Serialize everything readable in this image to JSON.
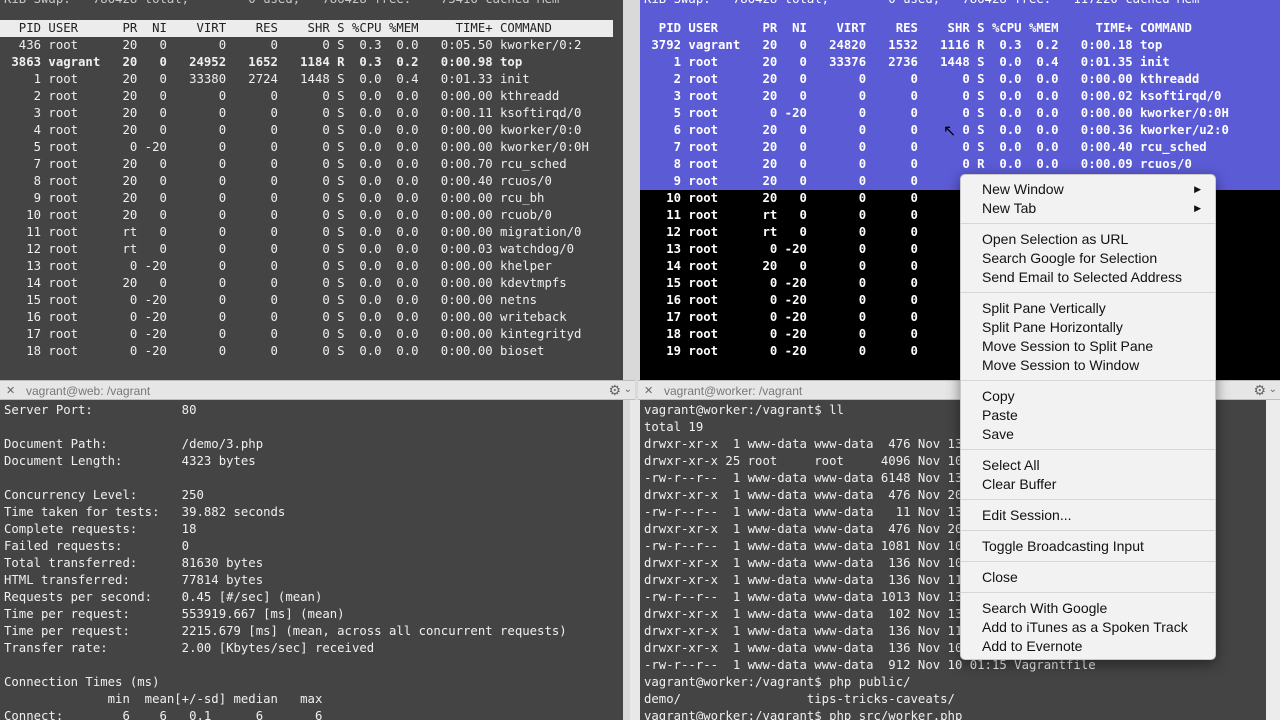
{
  "top_left": {
    "swap_line": "KiB Swap:   786428 total,        0 used,   786428 free.    73416 cached Mem",
    "header": "  PID USER      PR  NI    VIRT    RES    SHR S %CPU %MEM     TIME+ COMMAND",
    "rows": [
      {
        "text": "  436 root      20   0       0      0      0 S  0.3  0.0   0:05.50 kworker/0:2",
        "bold": false
      },
      {
        "text": " 3863 vagrant   20   0   24952   1652   1184 R  0.3  0.2   0:00.98 top",
        "bold": true
      },
      {
        "text": "    1 root      20   0   33380   2724   1448 S  0.0  0.4   0:01.33 init",
        "bold": false
      },
      {
        "text": "    2 root      20   0       0      0      0 S  0.0  0.0   0:00.00 kthreadd",
        "bold": false
      },
      {
        "text": "    3 root      20   0       0      0      0 S  0.0  0.0   0:00.11 ksoftirqd/0",
        "bold": false
      },
      {
        "text": "    4 root      20   0       0      0      0 S  0.0  0.0   0:00.00 kworker/0:0",
        "bold": false
      },
      {
        "text": "    5 root       0 -20       0      0      0 S  0.0  0.0   0:00.00 kworker/0:0H",
        "bold": false
      },
      {
        "text": "    7 root      20   0       0      0      0 S  0.0  0.0   0:00.70 rcu_sched",
        "bold": false
      },
      {
        "text": "    8 root      20   0       0      0      0 S  0.0  0.0   0:00.40 rcuos/0",
        "bold": false
      },
      {
        "text": "    9 root      20   0       0      0      0 S  0.0  0.0   0:00.00 rcu_bh",
        "bold": false
      },
      {
        "text": "   10 root      20   0       0      0      0 S  0.0  0.0   0:00.00 rcuob/0",
        "bold": false
      },
      {
        "text": "   11 root      rt   0       0      0      0 S  0.0  0.0   0:00.00 migration/0",
        "bold": false
      },
      {
        "text": "   12 root      rt   0       0      0      0 S  0.0  0.0   0:00.03 watchdog/0",
        "bold": false
      },
      {
        "text": "   13 root       0 -20       0      0      0 S  0.0  0.0   0:00.00 khelper",
        "bold": false
      },
      {
        "text": "   14 root      20   0       0      0      0 S  0.0  0.0   0:00.00 kdevtmpfs",
        "bold": false
      },
      {
        "text": "   15 root       0 -20       0      0      0 S  0.0  0.0   0:00.00 netns",
        "bold": false
      },
      {
        "text": "   16 root       0 -20       0      0      0 S  0.0  0.0   0:00.00 writeback",
        "bold": false
      },
      {
        "text": "   17 root       0 -20       0      0      0 S  0.0  0.0   0:00.00 kintegrityd",
        "bold": false
      },
      {
        "text": "   18 root       0 -20       0      0      0 S  0.0  0.0   0:00.00 bioset",
        "bold": false
      }
    ]
  },
  "top_right": {
    "swap_line": "KiB Swap:   786428 total,        0 used,   786428 free.   117220 cached Mem",
    "header": "  PID USER      PR  NI    VIRT    RES    SHR S %CPU %MEM     TIME+ COMMAND",
    "rows": [
      {
        "text": " 3792 vagrant   20   0   24820   1532   1116 R  0.3  0.2   0:00.18 top",
        "selected": true
      },
      {
        "text": "    1 root      20   0   33376   2736   1448 S  0.0  0.4   0:01.35 init",
        "selected": true
      },
      {
        "text": "    2 root      20   0       0      0      0 S  0.0  0.0   0:00.00 kthreadd",
        "selected": true
      },
      {
        "text": "    3 root      20   0       0      0      0 S  0.0  0.0   0:00.02 ksoftirqd/0",
        "selected": true
      },
      {
        "text": "    5 root       0 -20       0      0      0 S  0.0  0.0   0:00.00 kworker/0:0H",
        "selected": true
      },
      {
        "text": "    6 root      20   0       0      0      0 S  0.0  0.0   0:00.36 kworker/u2:0",
        "selected": true
      },
      {
        "text": "    7 root      20   0       0      0      0 S  0.0  0.0   0:00.40 rcu_sched",
        "selected": true
      },
      {
        "text": "    8 root      20   0       0      0      0 R  0.0  0.0   0:00.09 rcuos/0",
        "selected": true
      },
      {
        "text": "    9 root      20   0       0      0      0",
        "selected": true
      },
      {
        "text": "   10 root      20   0       0      0      0",
        "selected": false
      },
      {
        "text": "   11 root      rt   0       0      0      0",
        "selected": false
      },
      {
        "text": "   12 root      rt   0       0      0      0",
        "selected": false
      },
      {
        "text": "   13 root       0 -20       0      0      0",
        "selected": false
      },
      {
        "text": "   14 root      20   0       0      0      0",
        "selected": false
      },
      {
        "text": "   15 root       0 -20       0      0      0",
        "selected": false
      },
      {
        "text": "   16 root       0 -20       0      0      0",
        "selected": false
      },
      {
        "text": "   17 root       0 -20       0      0      0",
        "selected": false
      },
      {
        "text": "   18 root       0 -20       0      0      0",
        "selected": false
      },
      {
        "text": "   19 root       0 -20       0      0      0",
        "selected": false
      }
    ]
  },
  "title_left": "vagrant@web: /vagrant",
  "title_right": "vagrant@worker: /vagrant",
  "bottom_left": {
    "lines": [
      "Server Port:            80",
      "",
      "Document Path:          /demo/3.php",
      "Document Length:        4323 bytes",
      "",
      "Concurrency Level:      250",
      "Time taken for tests:   39.882 seconds",
      "Complete requests:      18",
      "Failed requests:        0",
      "Total transferred:      81630 bytes",
      "HTML transferred:       77814 bytes",
      "Requests per second:    0.45 [#/sec] (mean)",
      "Time per request:       553919.667 [ms] (mean)",
      "Time per request:       2215.679 [ms] (mean, across all concurrent requests)",
      "Transfer rate:          2.00 [Kbytes/sec] received",
      "",
      "Connection Times (ms)",
      "              min  mean[+/-sd] median   max",
      "Connect:        6    6   0.1      6       6"
    ]
  },
  "bottom_right": {
    "lines": [
      "vagrant@worker:/vagrant$ ll",
      "total 19",
      "drwxr-xr-x  1 www-data www-data  476 Nov 13 0",
      "drwxr-xr-x 25 root     root     4096 Nov 10 0",
      "-rw-r--r--  1 www-data www-data 6148 Nov 13 0",
      "drwxr-xr-x  1 www-data www-data  476 Nov 20 0",
      "-rw-r--r--  1 www-data www-data   11 Nov 13 0",
      "drwxr-xr-x  1 www-data www-data  476 Nov 20 0",
      "-rw-r--r--  1 www-data www-data 1081 Nov 10 0",
      "drwxr-xr-x  1 www-data www-data  136 Nov 10 0",
      "drwxr-xr-x  1 www-data www-data  136 Nov 11 0",
      "-rw-r--r--  1 www-data www-data 1013 Nov 13 0",
      "drwxr-xr-x  1 www-data www-data  102 Nov 13 0",
      "drwxr-xr-x  1 www-data www-data  136 Nov 11 0",
      "drwxr-xr-x  1 www-data www-data  136 Nov 10 0",
      "-rw-r--r--  1 www-data www-data  912 Nov 10 01:15 Vagrantfile",
      "vagrant@worker:/vagrant$ php public/",
      "demo/                 tips-tricks-caveats/",
      "vagrant@worker:/vagrant$ php src/worker.php"
    ]
  },
  "context_menu": {
    "groups": [
      [
        {
          "label": "New Window",
          "submenu": true
        },
        {
          "label": "New Tab",
          "submenu": true
        }
      ],
      [
        {
          "label": "Open Selection as URL",
          "submenu": false
        },
        {
          "label": "Search Google for Selection",
          "submenu": false
        },
        {
          "label": "Send Email to Selected Address",
          "submenu": false
        }
      ],
      [
        {
          "label": "Split Pane Vertically",
          "submenu": false
        },
        {
          "label": "Split Pane Horizontally",
          "submenu": false
        },
        {
          "label": "Move Session to Split Pane",
          "submenu": false
        },
        {
          "label": "Move Session to Window",
          "submenu": false
        }
      ],
      [
        {
          "label": "Copy",
          "submenu": false
        },
        {
          "label": "Paste",
          "submenu": false
        },
        {
          "label": "Save",
          "submenu": false
        }
      ],
      [
        {
          "label": "Select All",
          "submenu": false
        },
        {
          "label": "Clear Buffer",
          "submenu": false
        }
      ],
      [
        {
          "label": "Edit Session...",
          "submenu": false
        }
      ],
      [
        {
          "label": "Toggle Broadcasting Input",
          "submenu": false
        }
      ],
      [
        {
          "label": "Close",
          "submenu": false
        }
      ],
      [
        {
          "label": "Search With Google",
          "submenu": false
        },
        {
          "label": "Add to iTunes as a Spoken Track",
          "submenu": false
        },
        {
          "label": "Add to Evernote",
          "submenu": false
        }
      ]
    ]
  },
  "colors": {
    "selection": "#5b5bd6",
    "pane_bg": "#444444",
    "menu_bg": "#f2f2f2"
  },
  "icons": {
    "close": "close-icon",
    "gear": "gear-icon",
    "chevron": "chevron-down-icon",
    "submenu": "chevron-right-icon",
    "cursor": "mouse-pointer-icon"
  }
}
